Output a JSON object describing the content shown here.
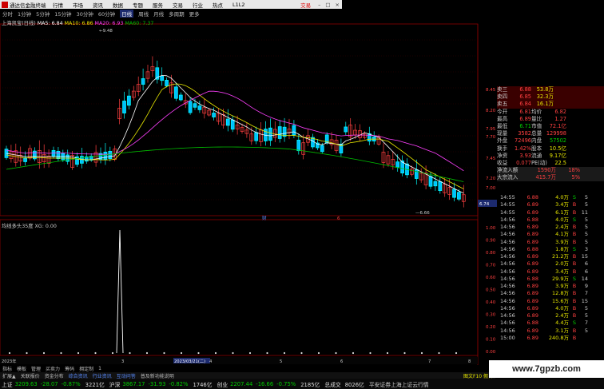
{
  "titlebar": {
    "app_name": "通达信金融终端",
    "menus": [
      "行情",
      "市场",
      "资讯",
      "数据",
      "专题",
      "服务",
      "交易",
      "行业",
      "热点",
      "L1L2"
    ],
    "trade_label": "交易"
  },
  "periods": {
    "items": [
      "分时",
      "1分钟",
      "5分钟",
      "15分钟",
      "30分钟",
      "60分钟",
      "日线",
      "周线",
      "月线",
      "多周期",
      "更多"
    ],
    "selected": "日线"
  },
  "legend": {
    "stock": "上海凯宝(日线)",
    "ma5": "MA5: 6.84",
    "ma10": "MA10: 6.86",
    "ma20": "MA20: 6.93",
    "ma60": "MA60: 7.37"
  },
  "price_axis": [
    "8.45",
    "8.20",
    "7.95",
    "7.70",
    "7.45",
    "7.20",
    "7.00",
    "6.74"
  ],
  "indicator_axis": [
    "1.00",
    "0.90",
    "0.80",
    "0.70",
    "0.60",
    "0.50",
    "0.40",
    "0.30",
    "0.20",
    "0.10",
    "0.00"
  ],
  "indicator": {
    "label": "均线多头35度  XG: 0.00"
  },
  "annotations": {
    "high": "9.48",
    "low": "6.66",
    "current": "6.74",
    "marker1": "财",
    "marker2": "6"
  },
  "date_axis": {
    "labels": [
      "2023年",
      "3",
      "2023/03/21(二)",
      "4",
      "5",
      "6",
      "7",
      "8"
    ]
  },
  "chart_data": {
    "type": "candlestick",
    "ma_colors": {
      "ma5": "#ffffff",
      "ma10": "#e8e800",
      "ma20": "#ff40ff",
      "ma60": "#00c000"
    }
  },
  "quote_panel": {
    "rows": [
      {
        "c1": "卖三",
        "c2": "6.88",
        "c3": "53.8万"
      },
      {
        "c1": "卖四",
        "c2": "6.85",
        "c3": "32.3万"
      },
      {
        "c1": "卖五",
        "c2": "6.84",
        "c3": "16.1万"
      },
      {
        "c1": "今开",
        "c2": "6.81",
        "c4": "均价",
        "c5": "6.82"
      },
      {
        "c1": "最高",
        "c2": "6.89",
        "c4": "量比",
        "c5": "1.27"
      },
      {
        "c1": "最低",
        "c2": "6.71",
        "c4": "市值",
        "c5": "72.1亿"
      },
      {
        "c1": "现量",
        "c2": "3582",
        "c4": "总量",
        "c5": "129998"
      },
      {
        "c1": "外盘",
        "c2": "72496",
        "c4": "内盘",
        "c5": "57502"
      },
      {
        "c1": "换手",
        "c2": "1.42%",
        "c4": "股本",
        "c5": "10.5亿"
      },
      {
        "c1": "净资",
        "c2": "3.93",
        "c4": "流通",
        "c5": "9.17亿"
      },
      {
        "c1": "收益(二)",
        "c2": "0.077",
        "c4": "PE(动)",
        "c5": "22.5"
      },
      {
        "c1": "净流入额",
        "c2": "",
        "c4": "1590万",
        "c5": "18%"
      },
      {
        "c1": "大宗流入",
        "c2": "",
        "c4": "415.7万",
        "c5": "5%"
      }
    ]
  },
  "ticks": [
    {
      "t": "14:55",
      "p": "6.88",
      "v": "4.0万",
      "bs": "S",
      "n": "5"
    },
    {
      "t": "14:55",
      "p": "6.89",
      "v": "3.4万",
      "bs": "B",
      "n": "5"
    },
    {
      "t": "14:55",
      "p": "6.89",
      "v": "6.1万",
      "bs": "B",
      "n": "11"
    },
    {
      "t": "14:56",
      "p": "6.88",
      "v": "4.0万",
      "bs": "S",
      "n": "5"
    },
    {
      "t": "14:56",
      "p": "6.89",
      "v": "2.4万",
      "bs": "B",
      "n": "5"
    },
    {
      "t": "14:56",
      "p": "6.89",
      "v": "4.1万",
      "bs": "B",
      "n": "5"
    },
    {
      "t": "14:56",
      "p": "6.89",
      "v": "3.9万",
      "bs": "B",
      "n": "5"
    },
    {
      "t": "14:56",
      "p": "6.88",
      "v": "1.8万",
      "bs": "S",
      "n": "3"
    },
    {
      "t": "14:56",
      "p": "6.89",
      "v": "21.2万",
      "bs": "B",
      "n": "15"
    },
    {
      "t": "14:56",
      "p": "6.89",
      "v": "2.0万",
      "bs": "B",
      "n": "6"
    },
    {
      "t": "14:56",
      "p": "6.89",
      "v": "3.4万",
      "bs": "B",
      "n": "6"
    },
    {
      "t": "14:56",
      "p": "6.88",
      "v": "29.9万",
      "bs": "S",
      "n": "14"
    },
    {
      "t": "14:56",
      "p": "6.89",
      "v": "3.9万",
      "bs": "B",
      "n": "9"
    },
    {
      "t": "14:56",
      "p": "6.89",
      "v": "12.8万",
      "bs": "B",
      "n": "7"
    },
    {
      "t": "14:56",
      "p": "6.89",
      "v": "15.6万",
      "bs": "B",
      "n": "15"
    },
    {
      "t": "14:56",
      "p": "6.89",
      "v": "4.0万",
      "bs": "B",
      "n": "5"
    },
    {
      "t": "14:56",
      "p": "6.89",
      "v": "2.4万",
      "bs": "B",
      "n": "5"
    },
    {
      "t": "14:56",
      "p": "6.88",
      "v": "4.4万",
      "bs": "S",
      "n": "7"
    },
    {
      "t": "14:56",
      "p": "6.89",
      "v": "3.1万",
      "bs": "B",
      "n": "5"
    },
    {
      "t": "15:00",
      "p": "6.89",
      "v": "240.8万",
      "bs": "B",
      "n": ""
    }
  ],
  "toolbar": {
    "items": [
      "指标",
      "模板",
      "管理",
      "买卖力",
      "筹码",
      "拥定制",
      "1"
    ]
  },
  "tabbar": {
    "items": [
      "扩展▲",
      "关联报价",
      "资金分布",
      "综合资讯",
      "行业资讯",
      "互动问答",
      "普及新功能说明"
    ],
    "right": "图文F10 假日"
  },
  "status": {
    "sh": {
      "name": "上证",
      "val": "3209.63",
      "chg": "-28.07",
      "pct": "-0.87%",
      "amt": "3221亿"
    },
    "hs": {
      "name": "沪深",
      "val": "3867.17",
      "chg": "-31.93",
      "pct": "-0.82%",
      "amt": "1746亿"
    },
    "cy": {
      "name": "创业",
      "val": "2207.44",
      "chg": "-16.66",
      "pct": "-0.75%",
      "amt": "2185亿"
    },
    "ex": {
      "name": "总成交",
      "amt": "8026亿"
    },
    "broker": "平安证券上海上证云行情"
  },
  "watermark": "www.7gpzb.com"
}
